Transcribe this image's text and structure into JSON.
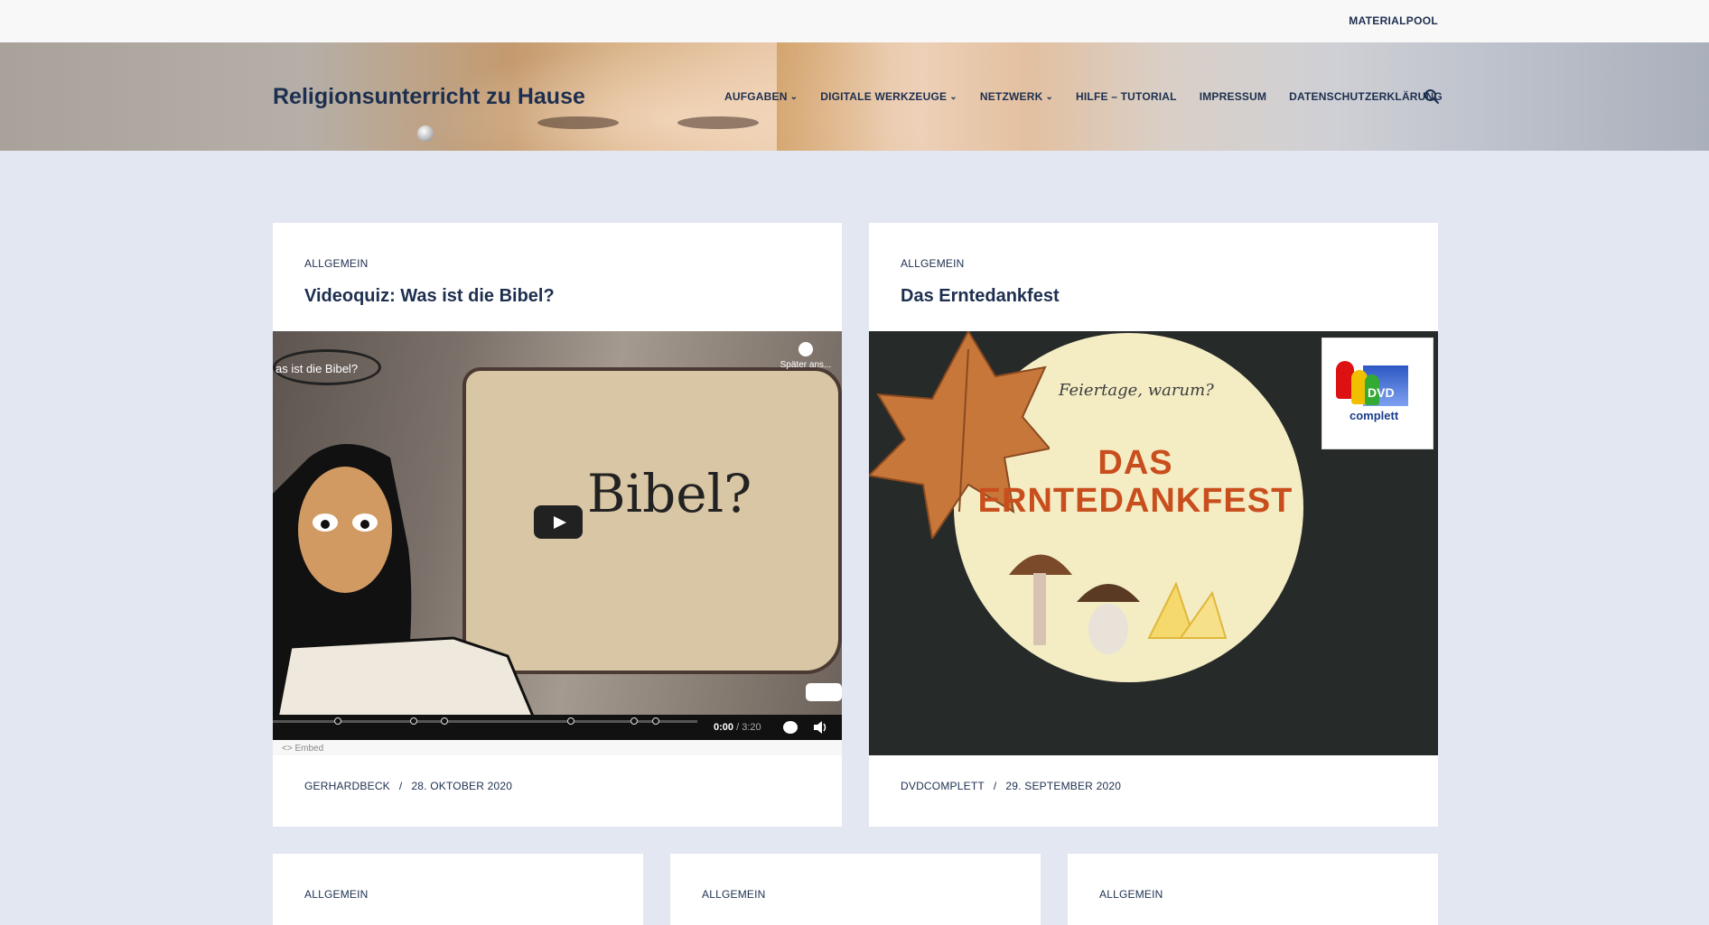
{
  "topbar": {
    "link": "MATERIALPOOL"
  },
  "header": {
    "site_title": "Religionsunterricht zu Hause",
    "nav": [
      {
        "label": "AUFGABEN",
        "has_dropdown": true
      },
      {
        "label": "DIGITALE WERKZEUGE",
        "has_dropdown": true
      },
      {
        "label": "NETZWERK",
        "has_dropdown": true
      },
      {
        "label": "HILFE – TUTORIAL",
        "has_dropdown": false
      },
      {
        "label": "IMPRESSUM",
        "has_dropdown": false
      },
      {
        "label": "DATENSCHUTZERKLÄRUNG",
        "has_dropdown": false
      }
    ],
    "chevron": "⌄",
    "search_icon": "search-icon"
  },
  "posts": [
    {
      "category": "ALLGEMEIN",
      "title": "Videoquiz: Was ist die Bibel?",
      "author": "GERHARDBECK",
      "separator": "/",
      "date": "28. OKTOBER 2020",
      "video": {
        "overlay_title": "as ist die Bibel?",
        "later_label": "Später ans...",
        "scroll_text": "Bibel?",
        "time_current": "0:00",
        "time_total": " / 3:20",
        "embed_label": "<> Embed"
      }
    },
    {
      "category": "ALLGEMEIN",
      "title": "Das Erntedankfest",
      "author": "DVDCOMPLETT",
      "separator": "/",
      "date": "29. SEPTEMBER 2020",
      "image": {
        "subtitle": "Feiertage, warum?",
        "title_line1": "DAS",
        "title_line2": "ERNTEDANKFEST",
        "badge_line1": "DVD",
        "badge_line2": "complett"
      }
    },
    {
      "category": "ALLGEMEIN"
    },
    {
      "category": "ALLGEMEIN"
    },
    {
      "category": "ALLGEMEIN"
    }
  ],
  "colors": {
    "accent": "#1d2f4f",
    "page_bg": "#e3e7f1",
    "card_bg": "#ffffff",
    "ernte_orange": "#c94e1e"
  }
}
